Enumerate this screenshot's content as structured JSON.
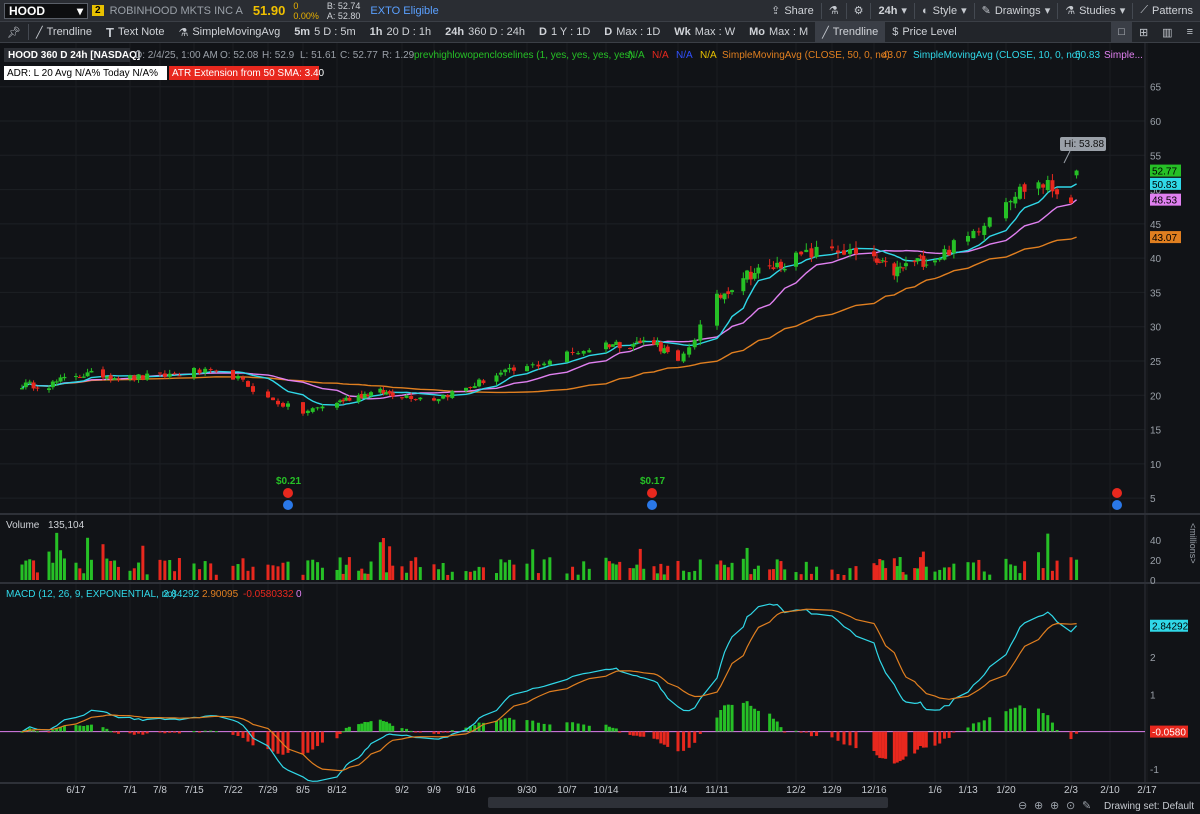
{
  "header": {
    "symbol": "HOOD",
    "link_badge": "2",
    "company": "ROBINHOOD MKTS INC A",
    "last": "51.90",
    "change": "0",
    "change_pct": "0.00%",
    "bid": "B: 52.74",
    "ask": "A: 52.80",
    "exto": "EXTO Eligible",
    "share": "Share",
    "aggregation": "24h",
    "style": "Style",
    "drawings": "Drawings",
    "studies": "Studies",
    "patterns": "Patterns"
  },
  "toolbar": {
    "trendline": "Trendline",
    "text_note": "Text Note",
    "sma": "SimpleMovingAvg",
    "presets": [
      {
        "key": "5m",
        "label": "5 D : 5m"
      },
      {
        "key": "1h",
        "label": "20 D : 1h"
      },
      {
        "key": "24h",
        "label": "360 D : 24h"
      },
      {
        "key": "D",
        "label": "1 Y : 1D"
      },
      {
        "key": "D",
        "label": "Max : 1D"
      },
      {
        "key": "Wk",
        "label": "Max : W"
      },
      {
        "key": "Mo",
        "label": "Max : M"
      }
    ],
    "trendline2": "Trendline",
    "price_level": "Price Level"
  },
  "price_panel": {
    "info": "HOOD 360 D 24h [NASDAQ]",
    "date": "D: 2/4/25, 1:00 AM",
    "open": "O: 52.08",
    "high": "H: 52.9",
    "low": "L: 51.61",
    "close": "C: 52.77",
    "range": "R: 1.29",
    "study1": "prevhighlowopencloselines (1, yes, yes, yes, yes)",
    "study1_vals": [
      "N/A",
      "N/A",
      "N/A",
      "N/A"
    ],
    "sma50_label": "SimpleMovingAvg (CLOSE, 50, 0, no)",
    "sma50_val": "43.07",
    "sma10_label": "SimpleMovingAvg (CLOSE, 10, 0, no)",
    "sma10_val": "50.83",
    "sma_more": "Simple...",
    "adr_text": "ADR: L 20  Avg N/A%  Today N/A%",
    "atr_text": "ATR Extension from 50 SMA: 3.40",
    "hi_label": "Hi: 53.88",
    "price_tags": {
      "close": "52.77",
      "sma10": "50.83",
      "sma20": "48.53",
      "sma50": "43.07"
    },
    "dividends": [
      "$0.21",
      "$0.17"
    ]
  },
  "volume_panel": {
    "label": "Volume",
    "value": "135,104",
    "unit": "<millions>"
  },
  "macd_panel": {
    "label": "MACD (12, 26, 9, EXPONENTIAL, no)",
    "value": "2.84292",
    "avg": "2.90095",
    "diff": "-0.0580332",
    "zero": "0",
    "tag_value": "2.84292",
    "tag_diff": "-0.0580"
  },
  "footer": {
    "drawing_set": "Drawing set: Default"
  },
  "colors": {
    "up": "#26c026",
    "down": "#e8281e",
    "sma10": "#30d8e8",
    "sma20": "#e080f0",
    "sma50": "#e07f20",
    "bg": "#111317"
  },
  "chart_data": {
    "type": "candlestick",
    "title": "HOOD 360 D 24h [NASDAQ]",
    "x_ticks": [
      "6/17",
      "7/1",
      "7/8",
      "7/15",
      "7/22",
      "7/29",
      "8/5",
      "8/12",
      "9/2",
      "9/9",
      "9/16",
      "9/30",
      "10/7",
      "10/14",
      "11/4",
      "11/11",
      "12/2",
      "12/9",
      "12/16",
      "1/6",
      "1/13",
      "1/20",
      "2/3",
      "2/10",
      "2/17"
    ],
    "price_ticks": [
      5,
      10,
      15,
      20,
      25,
      30,
      35,
      40,
      45,
      50,
      55,
      60,
      65
    ],
    "price_range": [
      4,
      67
    ],
    "close_anchors": {
      "dates": [
        "6/10",
        "6/17",
        "6/24",
        "7/1",
        "7/8",
        "7/15",
        "7/22",
        "7/29",
        "8/5",
        "8/12",
        "8/19",
        "8/26",
        "9/2",
        "9/9",
        "9/16",
        "9/23",
        "9/30",
        "10/7",
        "10/14",
        "10/21",
        "10/28",
        "11/4",
        "11/11",
        "11/18",
        "11/25",
        "12/2",
        "12/9",
        "12/16",
        "12/23",
        "12/30",
        "1/6",
        "1/13",
        "1/20",
        "1/27",
        "2/3",
        "2/4"
      ],
      "close": [
        21.5,
        23.0,
        23.0,
        22.5,
        22.8,
        23.5,
        22.8,
        19.5,
        17.5,
        19.0,
        20.0,
        20.5,
        20.0,
        19.5,
        21.0,
        23.0,
        24.0,
        26.0,
        27.5,
        27.5,
        28.0,
        24.5,
        34.0,
        37.5,
        38.5,
        40.0,
        41.5,
        39.5,
        38.0,
        39.5,
        40.0,
        43.0,
        49.0,
        51.0,
        49.0,
        52.77
      ]
    },
    "sma_last": {
      "sma10": 50.83,
      "sma20": 48.53,
      "sma50": 43.07
    },
    "high_marker": 53.88,
    "volume_ticks": [
      0,
      20,
      40
    ],
    "volume_unit": "millions",
    "macd_ticks": [
      -1,
      0,
      1,
      2
    ],
    "macd_last": {
      "value": 2.84292,
      "avg": 2.90095,
      "diff": -0.0580332
    }
  }
}
